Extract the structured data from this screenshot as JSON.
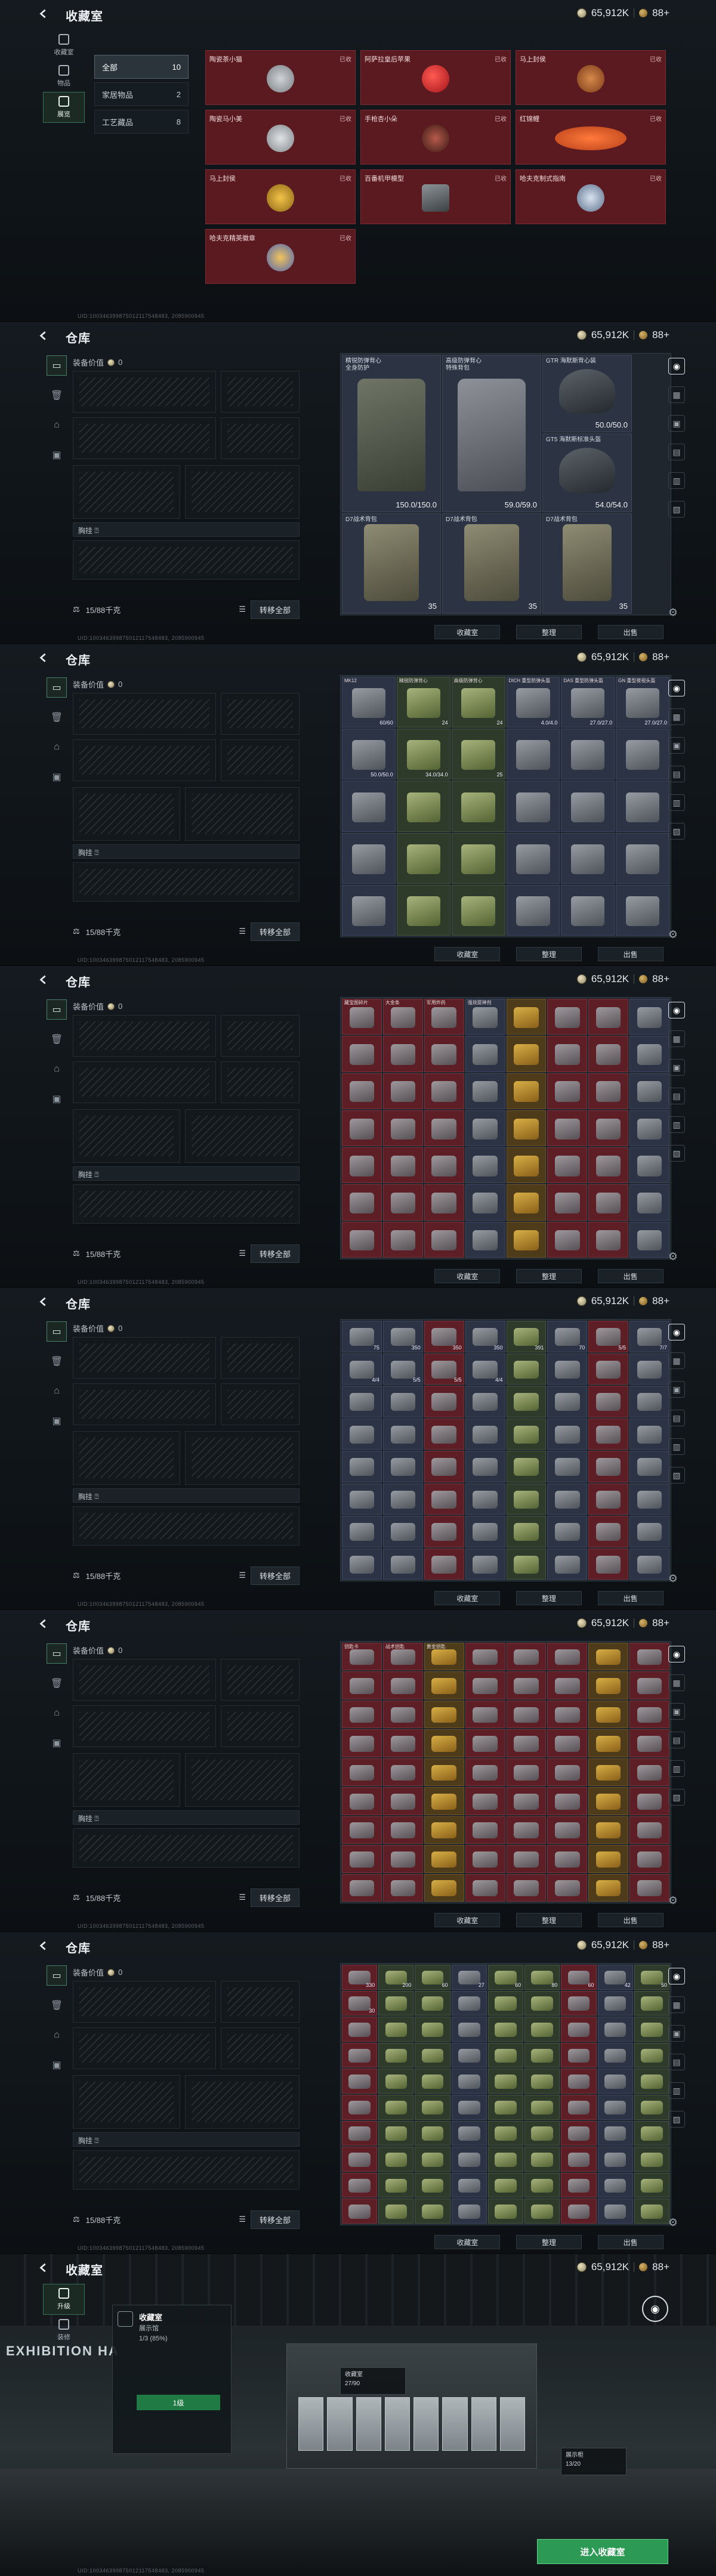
{
  "currency": {
    "amount": "65,912K",
    "level": "88+"
  },
  "footer_text": "UID:100346399875012117548483, 2085900945",
  "collection": {
    "title": "收藏室",
    "rail": [
      {
        "label": "收藏室"
      },
      {
        "label": "物品"
      },
      {
        "label": "展览"
      }
    ],
    "filters": [
      {
        "label": "全部",
        "count": "10"
      },
      {
        "label": "家居物品",
        "count": "2"
      },
      {
        "label": "工艺藏品",
        "count": "8"
      }
    ],
    "items": [
      {
        "name": "陶瓷茶小猫",
        "tag": "已收"
      },
      {
        "name": "阿萨拉皇后苹果",
        "tag": "已收"
      },
      {
        "name": "马上封侯",
        "tag": "已收"
      },
      {
        "name": "陶瓷马小美",
        "tag": "已收"
      },
      {
        "name": "手枪杏小朵",
        "tag": "已收"
      },
      {
        "name": "红锦鲤",
        "tag": "已收"
      },
      {
        "name": "马上封侯",
        "tag": "已收"
      },
      {
        "name": "百番机甲模型",
        "tag": "已收"
      },
      {
        "name": "哈夫克制式指南",
        "tag": "已收"
      },
      {
        "name": "哈夫克精英徽章",
        "tag": "已收"
      }
    ]
  },
  "warehouse": {
    "title": "仓库",
    "value_label": "装备价值",
    "value": "0",
    "chest_label": "胸挂",
    "capacity": "15/88千克",
    "transfer_label": "转移全部",
    "bottom_buttons": [
      "收藏室",
      "整理",
      "出售"
    ],
    "panel2_items": [
      {
        "name": "精锐防弹背心\n全身防护",
        "dur": "150.0/150.0"
      },
      {
        "name": "高级防弹背心\n特殊背包",
        "dur": "59.0/59.0"
      },
      {
        "name": "GTR 海默斯背心装",
        "dur": "50.0/50.0"
      },
      {
        "name": "GT5 海默斯标准头盔",
        "dur": "54.0/54.0"
      },
      {
        "name": "D7战术背包",
        "dur": "35"
      },
      {
        "name": "D7战术背包",
        "dur": "35"
      },
      {
        "name": "D7战术背包",
        "dur": "35"
      }
    ],
    "panel3_labels": [
      "MK12",
      "精锐防弹背心",
      "高级防弹背心",
      "DICH 重型防弹头盔",
      "DAS 重型防弹头盔",
      "GN 重型夜视头盔"
    ],
    "panel3_counts": [
      "60/60",
      "24",
      "24",
      "4.0/4.0",
      "27.0/27.0",
      "27.0/27.0",
      "50.0/50.0",
      "34.0/34.0",
      "25"
    ],
    "panel4_labels": [
      "藏宝图碎片",
      "大金条",
      "军用炸药",
      "强效提神剂"
    ],
    "panel5_counts": [
      "75",
      "350",
      "350",
      "350",
      "391",
      "70",
      "5/5",
      "7/7",
      "4/4",
      "5/5",
      "5/5",
      "4/4"
    ],
    "panel6_labels": [
      "钥匙卡",
      "战术钥匙",
      "黄金钥匙"
    ],
    "panel7_counts": [
      "330",
      "200",
      "60",
      "27",
      "60",
      "80",
      "60",
      "42",
      "50",
      "30"
    ]
  },
  "exhibition": {
    "title": "收藏室",
    "card_title": "收藏室",
    "card_sub": "展示馆",
    "card_btn": "1级",
    "card_line": "1/3 (85%)",
    "tip1": {
      "title": "收藏室",
      "sub": "升级中",
      "val": "27/90"
    },
    "tip2": {
      "title": "展示柜",
      "val": "13/20"
    },
    "sign": "EXHIBITION HA",
    "enter_label": "进入收藏室",
    "left_label1": "升级",
    "left_label2": "装修"
  }
}
